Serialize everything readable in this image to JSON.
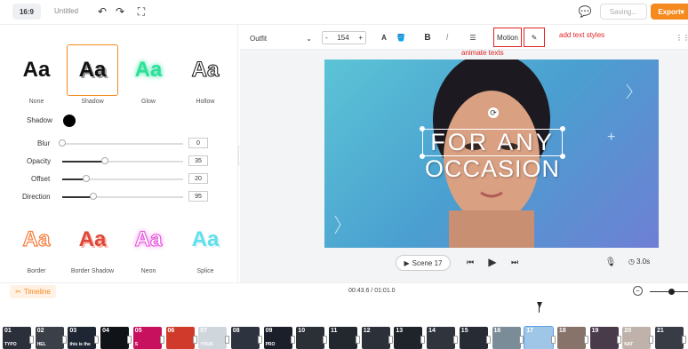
{
  "topbar": {
    "ratio": "16:9",
    "doc_title": "Untitled",
    "saving": "Saving...",
    "export": "Export"
  },
  "styles": {
    "row1": [
      {
        "label": "None",
        "sample": "Aa"
      },
      {
        "label": "Shadow",
        "sample": "Aa"
      },
      {
        "label": "Glow",
        "sample": "Aa"
      },
      {
        "label": "Hollow",
        "sample": "Aa"
      }
    ],
    "row2": [
      {
        "label": "Border",
        "sample": "Aa"
      },
      {
        "label": "Border Shadow",
        "sample": "Aa"
      },
      {
        "label": "Neon",
        "sample": "Aa"
      },
      {
        "label": "Splice",
        "sample": "Aa"
      }
    ]
  },
  "shadow": {
    "label": "Shadow",
    "color": "#000000",
    "controls": [
      {
        "label": "Blur",
        "value": "0",
        "fraction": 0.0
      },
      {
        "label": "Opacity",
        "value": "35",
        "fraction": 0.35
      },
      {
        "label": "Offset",
        "value": "20",
        "fraction": 0.2
      },
      {
        "label": "Direction",
        "value": "95",
        "fraction": 0.26
      }
    ]
  },
  "toolbar": {
    "font": "Outfit",
    "size": "154",
    "minus": "-",
    "plus": "+",
    "bold": "B",
    "italic": "I",
    "motion": "Motion",
    "animate_note": "animate texts",
    "style_note": "add text styles"
  },
  "canvas": {
    "line1": "FOR ANY",
    "line2": "OCCASION"
  },
  "scene": {
    "label": "Scene 17",
    "duration": "3.0s"
  },
  "timeline": {
    "label": "Timeline",
    "time": "00:43.6 / 01:01.0",
    "current_marker": "17"
  },
  "thumbs": [
    {
      "num": "01",
      "caption": "TYPO"
    },
    {
      "num": "02",
      "caption": "HEL"
    },
    {
      "num": "03",
      "caption": "this is the"
    },
    {
      "num": "04",
      "caption": ""
    },
    {
      "num": "05",
      "caption": "S"
    },
    {
      "num": "06",
      "caption": ""
    },
    {
      "num": "07",
      "caption": "YOUR"
    },
    {
      "num": "08",
      "caption": ""
    },
    {
      "num": "09",
      "caption": "PRO"
    },
    {
      "num": "10",
      "caption": ""
    },
    {
      "num": "11",
      "caption": ""
    },
    {
      "num": "12",
      "caption": ""
    },
    {
      "num": "13",
      "caption": ""
    },
    {
      "num": "14",
      "caption": ""
    },
    {
      "num": "15",
      "caption": ""
    },
    {
      "num": "16",
      "caption": ""
    },
    {
      "num": "17",
      "caption": ""
    },
    {
      "num": "18",
      "caption": ""
    },
    {
      "num": "19",
      "caption": ""
    },
    {
      "num": "20",
      "caption": "NAT"
    },
    {
      "num": "21",
      "caption": ""
    }
  ],
  "colors": {
    "accent": "#f58a1f",
    "annotation": "#e02424"
  }
}
